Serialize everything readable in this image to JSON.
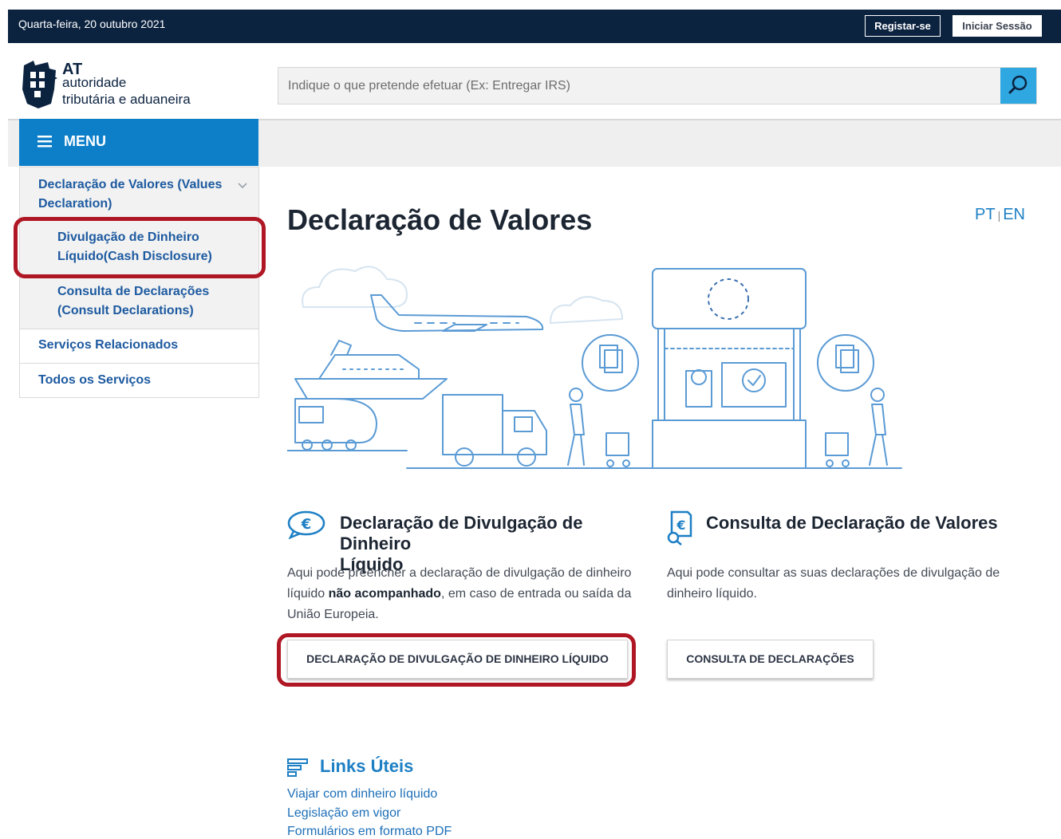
{
  "topbar": {
    "date": "Quarta-feira, 20 outubro 2021",
    "register_label": "Registar-se",
    "login_label": "Iniciar Sessão"
  },
  "header": {
    "logo": {
      "at": "AT",
      "line1": "autoridade",
      "line2": "tributária e aduaneira"
    },
    "search": {
      "placeholder": "Indique o que pretende efetuar (Ex: Entregar IRS)",
      "value": "",
      "icon": "search-icon"
    }
  },
  "menu": {
    "label": "MENU",
    "icon": "hamburger-icon"
  },
  "sidebar": {
    "group": {
      "line1": "Declaração de Valores (Values",
      "line2": "Declaration)",
      "icon": "chevron-down-icon"
    },
    "items": [
      {
        "line1": "Divulgação de Dinheiro",
        "line2": "Líquido(Cash Disclosure)"
      },
      {
        "line1": "Consulta de Declarações",
        "line2": "(Consult Declarations)"
      }
    ],
    "links": [
      "Serviços Relacionados",
      "Todos os Serviços"
    ]
  },
  "main": {
    "title": "Declaração de Valores",
    "lang": {
      "pt": "PT",
      "separator": "|",
      "en": "EN"
    },
    "illustration_icon": "travel-border-illustration",
    "cards": [
      {
        "icon": "euro-speech-icon",
        "title_line1": "Declaração de Divulgação de Dinheiro",
        "title_line2": "Líquido",
        "text_line1": "Aqui pode preencher a declaração de divulgação de dinheiro",
        "text_line2_a": "líquido ",
        "text_line2_bold": "não acompanhado",
        "text_line2_b": ", em caso de entrada ou saída da",
        "text_line3": "União Europeia.",
        "button": "DECLARAÇÃO DE DIVULGAÇÃO DE DINHEIRO LÍQUIDO"
      },
      {
        "icon": "document-search-icon",
        "title_line1": "Consulta de Declaração de Valores",
        "text_line1": "Aqui pode consultar as suas declarações de divulgação de",
        "text_line2": "dinheiro líquido.",
        "button": "CONSULTA DE DECLARAÇÕES"
      }
    ],
    "links": {
      "title": "Links Úteis",
      "icon": "list-icon",
      "items": [
        "Viajar com dinheiro líquido",
        "Legislação em vigor",
        "Formulários em formato PDF"
      ]
    }
  },
  "colors": {
    "navy": "#0c2340",
    "primary": "#0d7fc9",
    "search_button": "#2fa7e0",
    "highlight": "#b01724",
    "link": "#1d5aa0"
  }
}
